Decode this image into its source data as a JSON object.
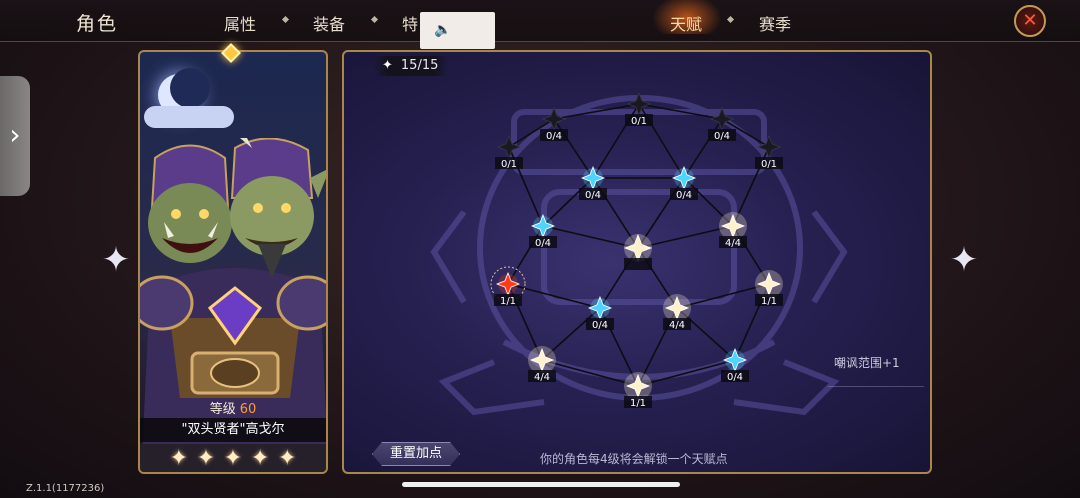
{
  "header": {
    "title": "角色",
    "tabs": [
      {
        "label": "属性",
        "active": false
      },
      {
        "label": "装备",
        "active": false
      },
      {
        "label": "特",
        "active": false
      },
      {
        "label": "天赋",
        "active": true
      },
      {
        "label": "赛季",
        "active": false
      }
    ],
    "close_icon": "close-x-icon"
  },
  "volume_popup": {
    "icon": "speaker-icon"
  },
  "character": {
    "level_label": "等级",
    "level_value": "60",
    "name": "\"双头贤者\"高戈尔",
    "stars": 5,
    "top_gem_icon": "diamond-gem-icon"
  },
  "talent": {
    "points": "15/15",
    "bonus_text": "嘲讽范围+1",
    "reset_label": "重置加点",
    "hint": "你的角色每4级将会解锁一个天赋点",
    "colors": {
      "active": "#fff1cc",
      "blue": "#4fd4ff",
      "red": "#ff3a1a",
      "locked": "#1a1820",
      "line": "#12101a"
    },
    "nodes": [
      {
        "id": "n1",
        "label": "0/1",
        "state": "locked"
      },
      {
        "id": "n2",
        "label": "0/4",
        "state": "locked"
      },
      {
        "id": "n3",
        "label": "0/1",
        "state": "locked"
      },
      {
        "id": "n4",
        "label": "0/4",
        "state": "locked"
      },
      {
        "id": "n5",
        "label": "0/1",
        "state": "locked"
      },
      {
        "id": "n6",
        "label": "0/4",
        "state": "blue"
      },
      {
        "id": "n7",
        "label": "0/4",
        "state": "blue"
      },
      {
        "id": "n8",
        "label": "0/4",
        "state": "blue"
      },
      {
        "id": "n9",
        "label": "",
        "state": "active"
      },
      {
        "id": "n10",
        "label": "4/4",
        "state": "active"
      },
      {
        "id": "n11",
        "label": "1/1",
        "state": "red"
      },
      {
        "id": "n12",
        "label": "1/1",
        "state": "active"
      },
      {
        "id": "n13",
        "label": "0/4",
        "state": "blue"
      },
      {
        "id": "n14",
        "label": "4/4",
        "state": "active"
      },
      {
        "id": "n15",
        "label": "4/4",
        "state": "active"
      },
      {
        "id": "n16",
        "label": "0/4",
        "state": "blue"
      },
      {
        "id": "n17",
        "label": "1/1",
        "state": "active"
      }
    ]
  },
  "footer": {
    "version": "Z.1.1(1177236)"
  }
}
